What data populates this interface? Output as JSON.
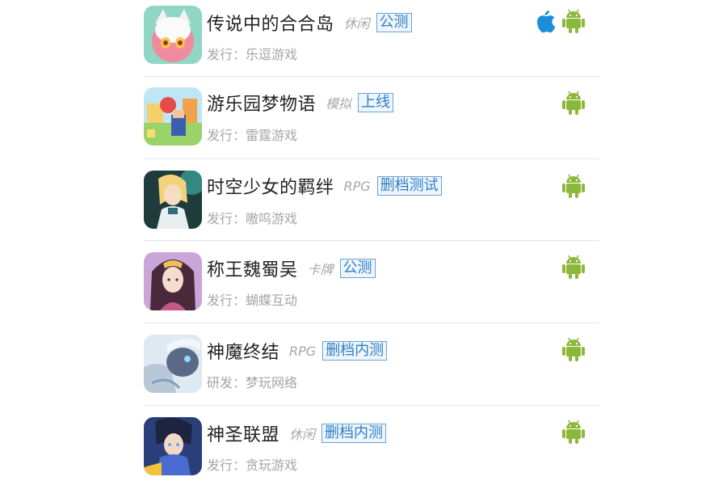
{
  "games": [
    {
      "name": "传说中的合合岛",
      "genre": "休闲",
      "status": "公测",
      "publisher": "发行：乐逗游戏",
      "platforms": [
        "apple-icon",
        "android-icon"
      ]
    },
    {
      "name": "游乐园梦物语",
      "genre": "模拟",
      "status": "上线",
      "publisher": "发行：雷霆游戏",
      "platforms": [
        "android-icon"
      ]
    },
    {
      "name": "时空少女的羁绊",
      "genre": "RPG",
      "status": "删档测试",
      "publisher": "发行：嗷呜游戏",
      "platforms": [
        "android-icon"
      ]
    },
    {
      "name": "称王魏蜀吴",
      "genre": "卡牌",
      "status": "公测",
      "publisher": "发行：蝴蝶互动",
      "platforms": [
        "android-icon"
      ]
    },
    {
      "name": "神魔终结",
      "genre": "RPG",
      "status": "删档内测",
      "publisher": "研发：梦玩网络",
      "platforms": [
        "android-icon"
      ]
    },
    {
      "name": "神圣联盟",
      "genre": "休闲",
      "status": "删档内测",
      "publisher": "发行：贪玩游戏",
      "platforms": [
        "android-icon"
      ]
    }
  ],
  "colors": {
    "android": "#8cb83a",
    "apple": "#1a8fd8",
    "status_text": "#2f7fc4"
  }
}
